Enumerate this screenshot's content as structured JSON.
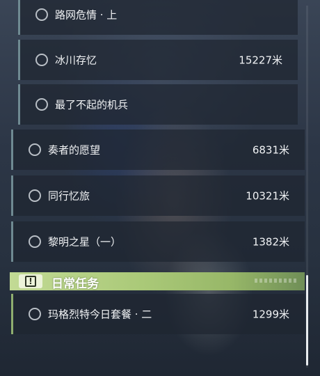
{
  "quests_story": [
    {
      "title": "路网危情 · 上",
      "distance": ""
    },
    {
      "title": "冰川存忆",
      "distance": "15227米"
    },
    {
      "title": "最了不起的机兵",
      "distance": ""
    }
  ],
  "quests_main": [
    {
      "title": "奏者的愿望",
      "distance": "6831米"
    },
    {
      "title": "同行忆旅",
      "distance": "10321米"
    },
    {
      "title": "黎明之星（一）",
      "distance": "1382米"
    }
  ],
  "daily": {
    "header_icon": "!",
    "header_title": "日常任务",
    "items": [
      {
        "title": "玛格烈特今日套餐 · 二",
        "distance": "1299米"
      }
    ]
  },
  "colors": {
    "panel_accent": "#6f8a92",
    "daily_green": "#aac978"
  },
  "icons": {
    "status": "circle-outline-icon",
    "daily": "exclamation-icon"
  }
}
